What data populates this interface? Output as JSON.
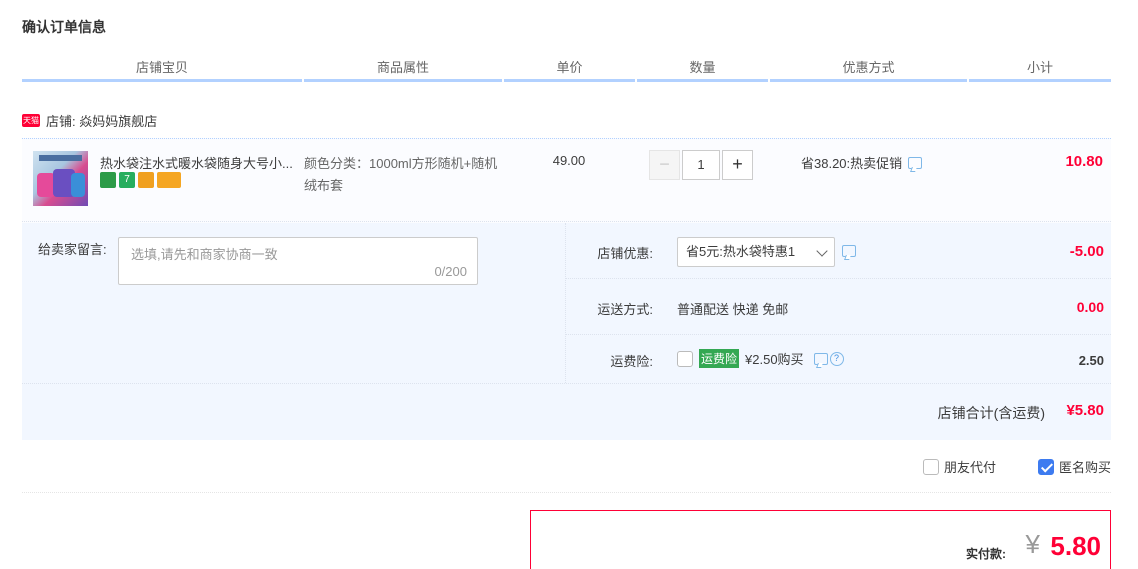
{
  "page": {
    "title": "确认订单信息"
  },
  "table_headers": [
    "店铺宝贝",
    "商品属性",
    "单价",
    "数量",
    "优惠方式",
    "小计"
  ],
  "shop": {
    "badge": "天猫",
    "label": "店铺: 焱妈妈旗舰店"
  },
  "item": {
    "title": "热水袋注水式暖水袋随身大号小...",
    "attribute": "颜色分类：1000ml方形随机+随机绒布套",
    "price": "49.00",
    "quantity": "1",
    "minus_label": "−",
    "plus_label": "+",
    "promotion": "省38.20:热卖促销",
    "subtotal": "10.80"
  },
  "message": {
    "label": "给卖家留言:",
    "placeholder": "选填,请先和商家协商一致",
    "counter": "0/200"
  },
  "discount": {
    "label": "店铺优惠:",
    "selected": "省5元:热水袋特惠1",
    "amount": "-5.00"
  },
  "shipping": {
    "label": "运送方式:",
    "value": "普通配送 快递 免邮",
    "amount": "0.00"
  },
  "insurance": {
    "label": "运费险:",
    "tag": "运费险",
    "price_text": "¥2.50购买",
    "amount": "2.50",
    "help": "?"
  },
  "shop_total": {
    "label": "店铺合计(含运费)",
    "amount": "¥5.80"
  },
  "options": {
    "friend_pay": "朋友代付",
    "anonymous": "匿名购买"
  },
  "payment": {
    "label": "实付款:",
    "currency": "¥",
    "amount": "5.80"
  },
  "colors": {
    "accent": "#ff0036",
    "header_border": "#b2d1ff",
    "panel_bg": "#f2f7ff",
    "checkbox_checked": "#3d7bf0"
  }
}
